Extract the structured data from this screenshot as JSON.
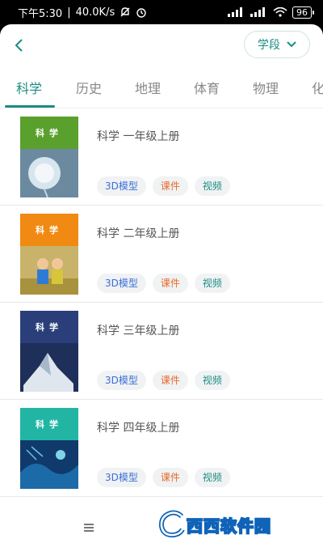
{
  "status": {
    "time": "下午5:30",
    "speed": "40.0K/s",
    "battery": "96"
  },
  "header": {
    "stage_label": "学段"
  },
  "tabs": [
    {
      "label": "科学"
    },
    {
      "label": "历史"
    },
    {
      "label": "地理"
    },
    {
      "label": "体育"
    },
    {
      "label": "物理"
    },
    {
      "label": "化"
    }
  ],
  "books": [
    {
      "title": "科学 一年级上册",
      "cover_title": "科学",
      "cover_color": "#5aa02c",
      "chips": [
        "3D模型",
        "课件",
        "视频"
      ]
    },
    {
      "title": "科学 二年级上册",
      "cover_title": "科学",
      "cover_color": "#f08a12",
      "chips": [
        "3D模型",
        "课件",
        "视频"
      ]
    },
    {
      "title": "科学 三年级上册",
      "cover_title": "科学",
      "cover_color": "#2a3f7a",
      "chips": [
        "3D模型",
        "课件",
        "视频"
      ]
    },
    {
      "title": "科学 四年级上册",
      "cover_title": "科学",
      "cover_color": "#22b5a4",
      "chips": [
        "3D模型",
        "课件",
        "视频"
      ]
    }
  ],
  "watermark": {
    "text": "西西软件园"
  },
  "colors": {
    "accent": "#1b8c83",
    "chip_3d": "#3b6fd6",
    "chip_courseware": "#e66c2c",
    "chip_video": "#1b8c83"
  }
}
